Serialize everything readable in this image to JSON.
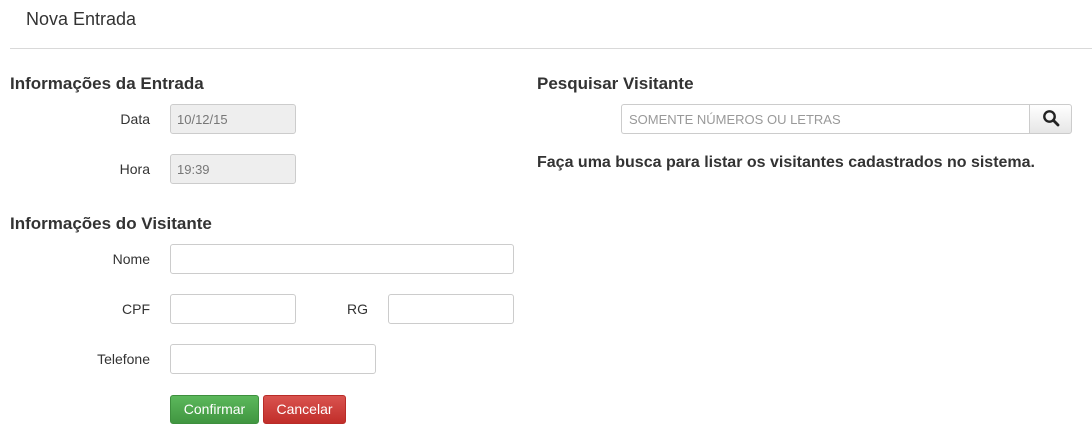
{
  "header": {
    "title": "Nova Entrada"
  },
  "entrada": {
    "heading": "Informações da Entrada",
    "data_label": "Data",
    "data_value": "10/12/15",
    "hora_label": "Hora",
    "hora_value": "19:39"
  },
  "visitante": {
    "heading": "Informações do Visitante",
    "nome_label": "Nome",
    "nome_value": "",
    "cpf_label": "CPF",
    "cpf_value": "",
    "rg_label": "RG",
    "rg_value": "",
    "telefone_label": "Telefone",
    "telefone_value": ""
  },
  "actions": {
    "confirm_label": "Confirmar",
    "cancel_label": "Cancelar"
  },
  "search": {
    "heading": "Pesquisar Visitante",
    "placeholder": "SOMENTE NÚMEROS OU LETRAS",
    "button_icon": "search-icon",
    "helper_text": "Faça uma busca para listar os visitantes cadastrados no sistema."
  },
  "colors": {
    "confirm": "#5cb85c",
    "cancel": "#d9534f",
    "readonly_bg": "#eeeeee"
  }
}
